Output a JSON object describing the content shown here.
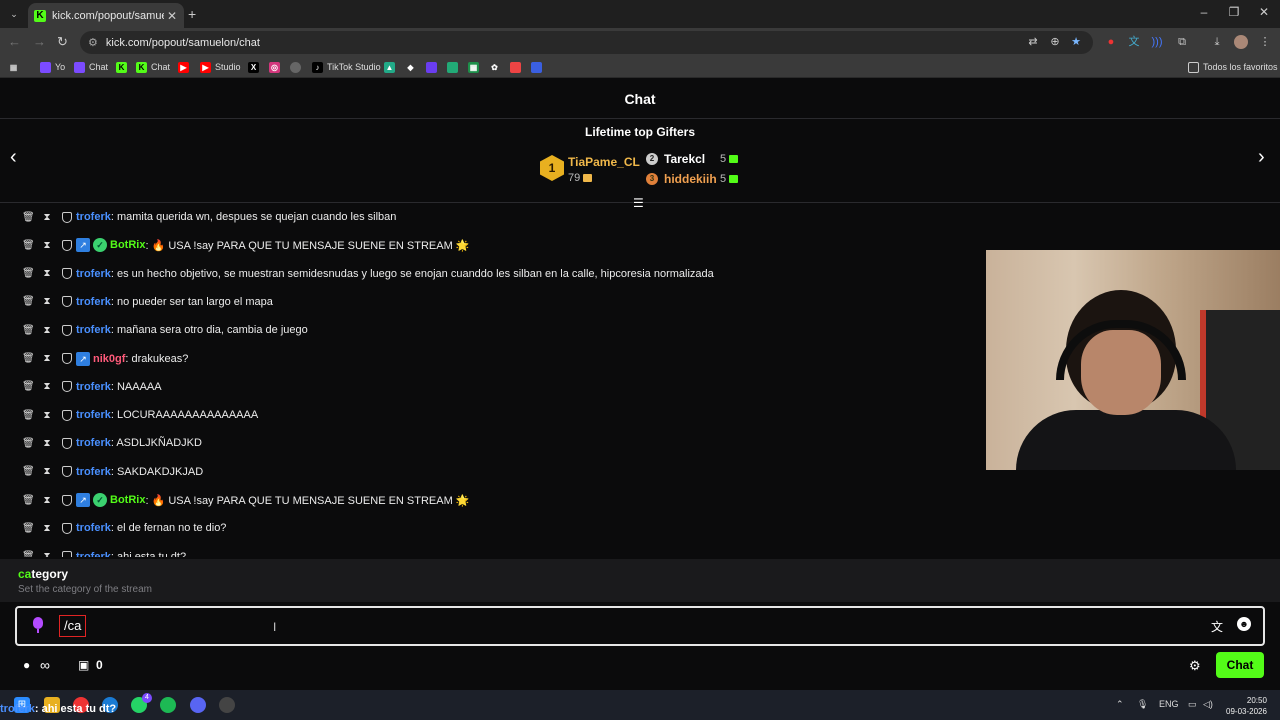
{
  "browser": {
    "tab_title": "kick.com/popout/samuelon/ch",
    "url": "kick.com/popout/samuelon/chat",
    "bookmarks": [
      "Yo",
      "Chat",
      "Chat",
      "Studio",
      "TikTok Studio"
    ],
    "all_bookmarks": "Todos los favoritos"
  },
  "chat": {
    "header": "Chat",
    "gifters_title": "Lifetime top Gifters",
    "gifters": [
      {
        "rank": "1",
        "name": "TiaPame_CL",
        "count": "79"
      },
      {
        "rank": "2",
        "name": "Tarekcl",
        "count": "5"
      },
      {
        "rank": "3",
        "name": "hiddekiih",
        "count": "5"
      }
    ],
    "messages": [
      {
        "user": "troferk",
        "text": ": mamita querida wn, despues se quejan cuando les silban",
        "badges": []
      },
      {
        "user": "BotRix",
        "text": ": 🔥 USA !say PARA QUE TU MENSAJE SUENE EN STREAM 🌟",
        "badges": [
          "bot",
          "verified"
        ]
      },
      {
        "user": "troferk",
        "text": ": es un hecho objetivo, se muestran semidesnudas y luego se enojan cuanddo les silban en la calle, hipcoresia normalizada",
        "badges": []
      },
      {
        "user": "troferk",
        "text": ": no pueder ser tan largo el mapa",
        "badges": []
      },
      {
        "user": "troferk",
        "text": ": mañana sera otro dia, cambia de juego",
        "badges": []
      },
      {
        "user": "nik0gf",
        "text": ": drakukeas?",
        "badges": [
          "bot"
        ]
      },
      {
        "user": "troferk",
        "text": ": NAAAAA",
        "badges": []
      },
      {
        "user": "troferk",
        "text": ": LOCURAAAAAAAAAAAAAA",
        "badges": []
      },
      {
        "user": "troferk",
        "text": ": ASDLJKÑADJKD",
        "badges": []
      },
      {
        "user": "troferk",
        "text": ": SAKDAKDJKJAD",
        "badges": []
      },
      {
        "user": "BotRix",
        "text": ": 🔥 USA !say PARA QUE TU MENSAJE SUENE EN STREAM 🌟",
        "badges": [
          "bot",
          "verified"
        ]
      },
      {
        "user": "troferk",
        "text": ": el de fernan no te dio?",
        "badges": []
      },
      {
        "user": "troferk",
        "text": ": ahi esta tu dt?",
        "badges": []
      }
    ],
    "suggestion": {
      "match": "ca",
      "rest": "tegory",
      "description": "Set the category of the stream"
    },
    "input_value": "/ca",
    "points": "∞",
    "gift_count": "0",
    "send_label": "Chat"
  },
  "taskbar": {
    "overlay_user": "troferk",
    "overlay_text": "ahi esta tu dt?",
    "lang": "ENG",
    "time": "20:50",
    "date": "09-03-2026",
    "whatsapp_badge": "4"
  },
  "colors": {
    "kick_green": "#53fc18",
    "user_blue": "#4a90ff",
    "botrix_green": "#53fc18",
    "nik_red": "#ff5a7a",
    "gold": "#f0b84a"
  }
}
